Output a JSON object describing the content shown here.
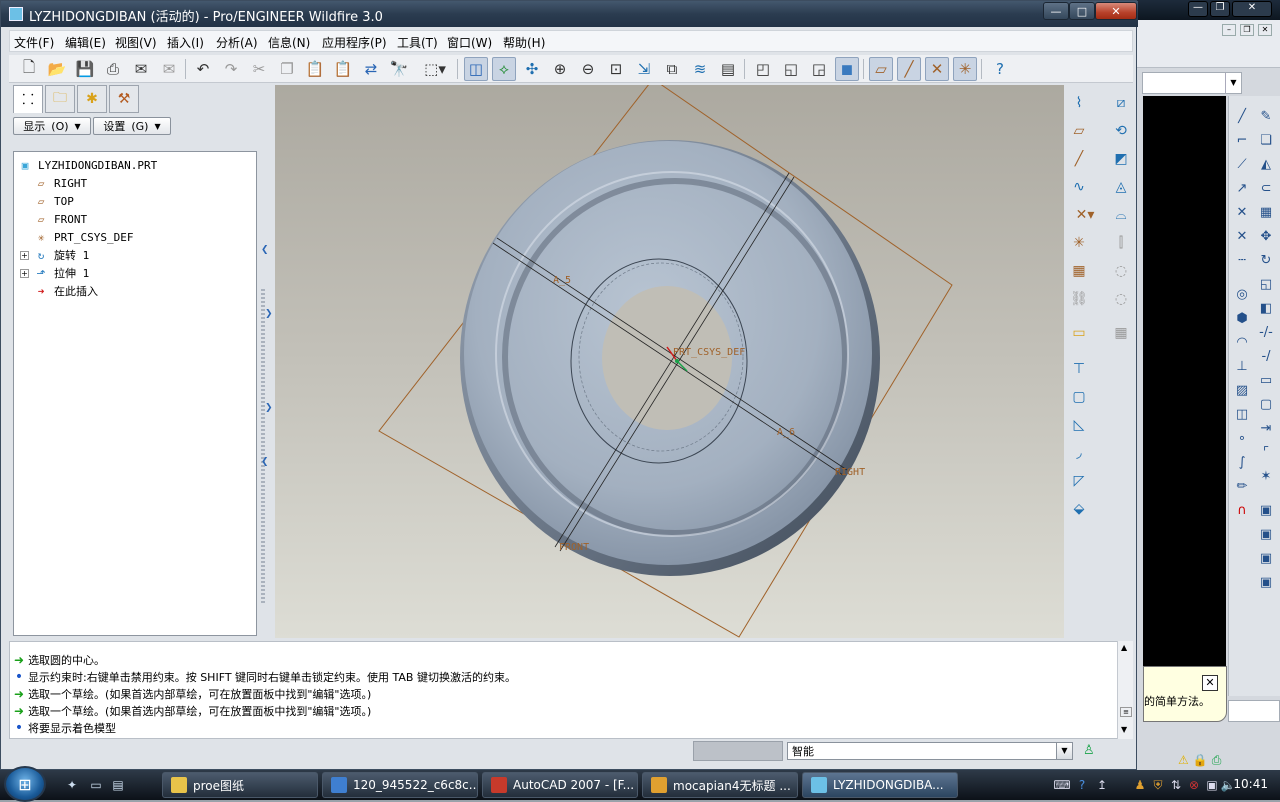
{
  "window": {
    "title": "LYZHIDONGDIBAN (活动的) - Pro/ENGINEER Wildfire 3.0",
    "minimize_glyph": "—",
    "maximize_glyph": "□",
    "close_glyph": "✕"
  },
  "menus": [
    "文件(F)",
    "编辑(E)",
    "视图(V)",
    "插入(I)",
    "分析(A)",
    "信息(N)",
    "应用程序(P)",
    "工具(T)",
    "窗口(W)",
    "帮助(H)"
  ],
  "navigator": {
    "show_label": "显示",
    "show_key": "(O)",
    "settings_label": "设置",
    "settings_key": "(G)",
    "tree": [
      {
        "label": "LYZHIDONGDIBAN.PRT",
        "icon": "part-icon"
      },
      {
        "label": "RIGHT",
        "icon": "datum-plane-icon"
      },
      {
        "label": "TOP",
        "icon": "datum-plane-icon"
      },
      {
        "label": "FRONT",
        "icon": "datum-plane-icon"
      },
      {
        "label": "PRT_CSYS_DEF",
        "icon": "csys-icon"
      },
      {
        "label": "旋转 1",
        "icon": "revolve-icon"
      },
      {
        "label": "拉伸 1",
        "icon": "extrude-icon"
      },
      {
        "label": "在此插入",
        "icon": "insert-here-arrow-icon"
      }
    ]
  },
  "viewport": {
    "labels": {
      "axis_a5": "A_5",
      "axis_a6": "A_6",
      "csys": "PRT_CSYS_DEF",
      "right": "RIGHT",
      "front": "FRONT"
    }
  },
  "messages": [
    {
      "type": "prompt",
      "text": "选取圆的中心。"
    },
    {
      "type": "info",
      "text": "显示约束时:右键单击禁用约束。按 SHIFT 键同时右键单击锁定约束。使用 TAB 键切换激活的约束。"
    },
    {
      "type": "prompt",
      "text": "选取一个草绘。(如果首选内部草绘，可在放置面板中找到\"编辑\"选项。)"
    },
    {
      "type": "prompt",
      "text": "选取一个草绘。(如果首选内部草绘，可在放置面板中找到\"编辑\"选项。)"
    },
    {
      "type": "info",
      "text": "将要显示着色模型"
    }
  ],
  "status": {
    "filter_value": "智能"
  },
  "tooltip": {
    "text": "的简单方法。"
  },
  "taskbar": {
    "tasks": [
      {
        "label": "proe图纸",
        "color": "#e8c34a"
      },
      {
        "label": "120_945522_c6c8c...",
        "color": "#3f7fd0"
      },
      {
        "label": "AutoCAD 2007 - [F...",
        "color": "#c73a2b"
      },
      {
        "label": "mocapian4无标题 ...",
        "color": "#e0a030"
      },
      {
        "label": "LYZHIDONGDIBA...",
        "color": "#6cc0e6"
      }
    ],
    "clock": "10:41"
  },
  "colors": {
    "title_bar": "#2b3c50",
    "datum": "#a0622a",
    "model": "#a9b6c5",
    "prompt_arrow": "#19a019",
    "info_dot": "#1a55c9"
  }
}
